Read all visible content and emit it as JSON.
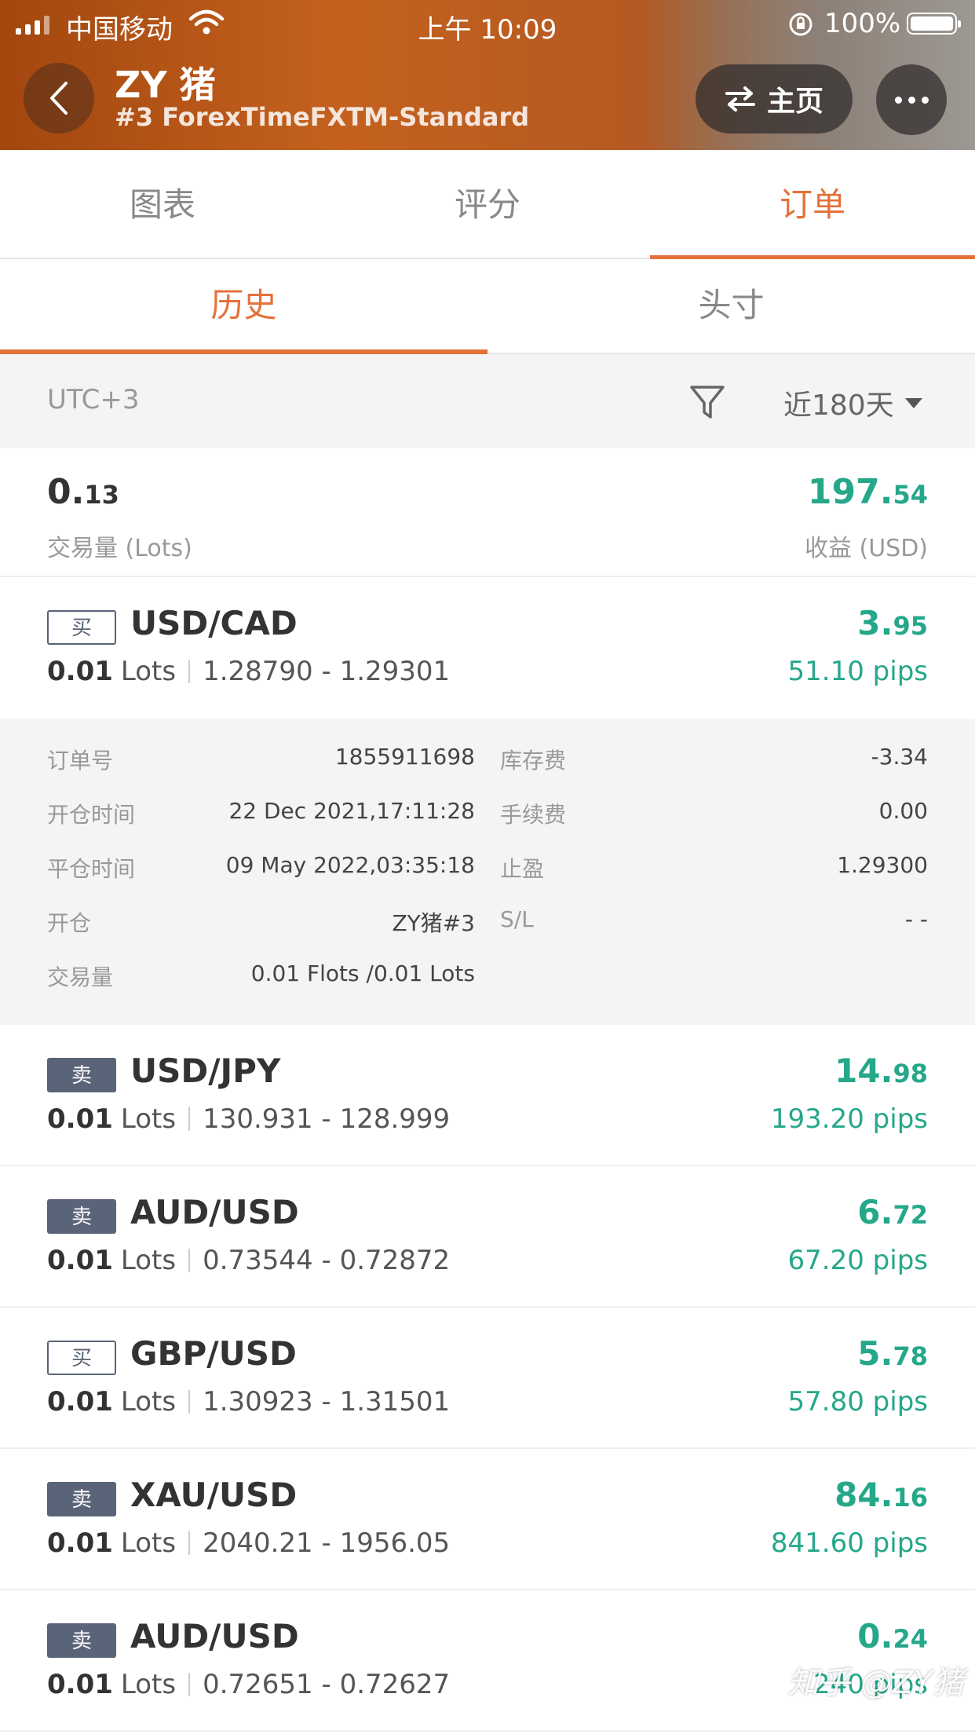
{
  "status_bar": {
    "carrier": "中国移动",
    "time": "上午 10:09",
    "battery": "100%"
  },
  "header": {
    "title": "ZY 猪",
    "subtitle": "#3 ForexTimeFXTM-Standard",
    "home_label": "主页"
  },
  "tabs": [
    "图表",
    "评分",
    "订单"
  ],
  "subtabs": [
    "历史",
    "头寸"
  ],
  "filter": {
    "timezone": "UTC+3",
    "range": "近180天"
  },
  "summary": {
    "volume_main": "0.",
    "volume_small": "13",
    "volume_label": "交易量 (Lots)",
    "profit_main": "197.",
    "profit_small": "54",
    "profit_label": "收益 (USD)"
  },
  "orders": [
    {
      "side": "买",
      "symbol": "USD/CAD",
      "lots": "0.01",
      "lot_unit": "Lots",
      "price_range": "1.28790 - 1.29301",
      "profit_main": "3.",
      "profit_small": "95",
      "pips": "51.10 pips"
    },
    {
      "side": "卖",
      "symbol": "USD/JPY",
      "lots": "0.01",
      "lot_unit": "Lots",
      "price_range": "130.931 - 128.999",
      "profit_main": "14.",
      "profit_small": "98",
      "pips": "193.20 pips"
    },
    {
      "side": "卖",
      "symbol": "AUD/USD",
      "lots": "0.01",
      "lot_unit": "Lots",
      "price_range": "0.73544 - 0.72872",
      "profit_main": "6.",
      "profit_small": "72",
      "pips": "67.20 pips"
    },
    {
      "side": "买",
      "symbol": "GBP/USD",
      "lots": "0.01",
      "lot_unit": "Lots",
      "price_range": "1.30923 - 1.31501",
      "profit_main": "5.",
      "profit_small": "78",
      "pips": "57.80 pips"
    },
    {
      "side": "卖",
      "symbol": "XAU/USD",
      "lots": "0.01",
      "lot_unit": "Lots",
      "price_range": "2040.21 - 1956.05",
      "profit_main": "84.",
      "profit_small": "16",
      "pips": "841.60 pips"
    },
    {
      "side": "卖",
      "symbol": "AUD/USD",
      "lots": "0.01",
      "lot_unit": "Lots",
      "price_range": "0.72651 - 0.72627",
      "profit_main": "0.",
      "profit_small": "24",
      "pips": "240 pips"
    }
  ],
  "detail": {
    "order_no_label": "订单号",
    "order_no": "1855911698",
    "swap_label": "库存费",
    "swap": "-3.34",
    "open_time_label": "开仓时间",
    "open_time": "22 Dec 2021,17:11:28",
    "fee_label": "手续费",
    "fee": "0.00",
    "close_time_label": "平仓时间",
    "close_time": "09 May 2022,03:35:18",
    "tp_label": "止盈",
    "tp": "1.29300",
    "open_label": "开仓",
    "open": "ZY猪#3",
    "sl_label": "S/L",
    "sl": "- -",
    "volume_label": "交易量",
    "volume": "0.01 Flots /0.01 Lots"
  },
  "watermark": "知乎 @ZY猪"
}
